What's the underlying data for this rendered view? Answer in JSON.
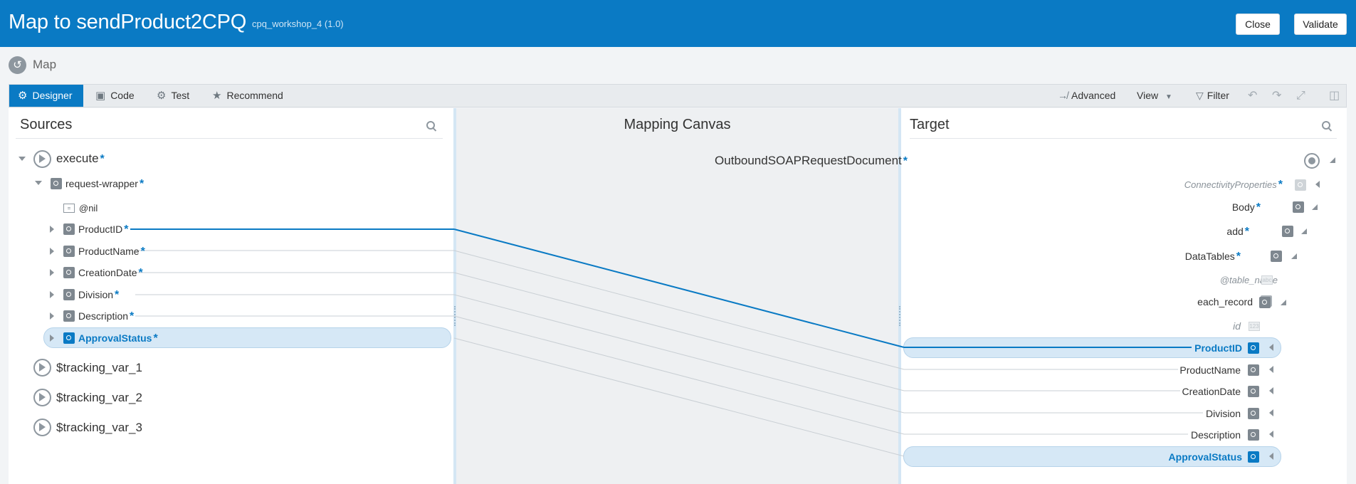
{
  "header": {
    "title": "Map to sendProduct2CPQ",
    "subtitle": "cpq_workshop_4 (1.0)",
    "close_label": "Close",
    "validate_label": "Validate",
    "bg_color": "#0a7ac4"
  },
  "mapbar": {
    "label": "Map"
  },
  "toolbar": {
    "tabs": [
      {
        "label": "Designer",
        "icon": "designer-icon",
        "active": true
      },
      {
        "label": "Code",
        "icon": "code-icon"
      },
      {
        "label": "Test",
        "icon": "gear-icon"
      },
      {
        "label": "Recommend",
        "icon": "star-icon"
      }
    ],
    "advanced_label": "Advanced",
    "view_label": "View",
    "filter_label": "Filter"
  },
  "sources": {
    "title": "Sources",
    "nodes": [
      {
        "label": "execute",
        "required": "*"
      },
      {
        "label": "request-wrapper",
        "required": "*"
      },
      {
        "label": "@nil"
      },
      {
        "label": "ProductID",
        "required": "*"
      },
      {
        "label": "ProductName",
        "required": "*"
      },
      {
        "label": "CreationDate",
        "required": "*"
      },
      {
        "label": "Division",
        "required": "*"
      },
      {
        "label": "Description",
        "required": "*"
      },
      {
        "label": "ApprovalStatus",
        "required": "*"
      },
      {
        "label": "$tracking_var_1"
      },
      {
        "label": "$tracking_var_2"
      },
      {
        "label": "$tracking_var_3"
      }
    ]
  },
  "canvas": {
    "title": "Mapping Canvas"
  },
  "target": {
    "title": "Target",
    "nodes": [
      {
        "label": "OutboundSOAPRequestDocument",
        "required": "*"
      },
      {
        "label": "ConnectivityProperties",
        "required": "*"
      },
      {
        "label": "Body",
        "required": "*"
      },
      {
        "label": "add",
        "required": "*"
      },
      {
        "label": "DataTables",
        "required": "*"
      },
      {
        "label": "@table_name"
      },
      {
        "label": "each_record"
      },
      {
        "label": "id"
      },
      {
        "label": "ProductID"
      },
      {
        "label": "ProductName"
      },
      {
        "label": "CreationDate"
      },
      {
        "label": "Division"
      },
      {
        "label": "Description"
      },
      {
        "label": "ApprovalStatus"
      }
    ]
  },
  "mappings": [
    {
      "source": "ProductID",
      "target": "ProductID",
      "selected": true
    },
    {
      "source": "ProductName",
      "target": "ProductName"
    },
    {
      "source": "CreationDate",
      "target": "CreationDate"
    },
    {
      "source": "Division",
      "target": "Division"
    },
    {
      "source": "Description",
      "target": "Description"
    },
    {
      "source": "ApprovalStatus",
      "target": "ApprovalStatus",
      "selected": true
    }
  ]
}
